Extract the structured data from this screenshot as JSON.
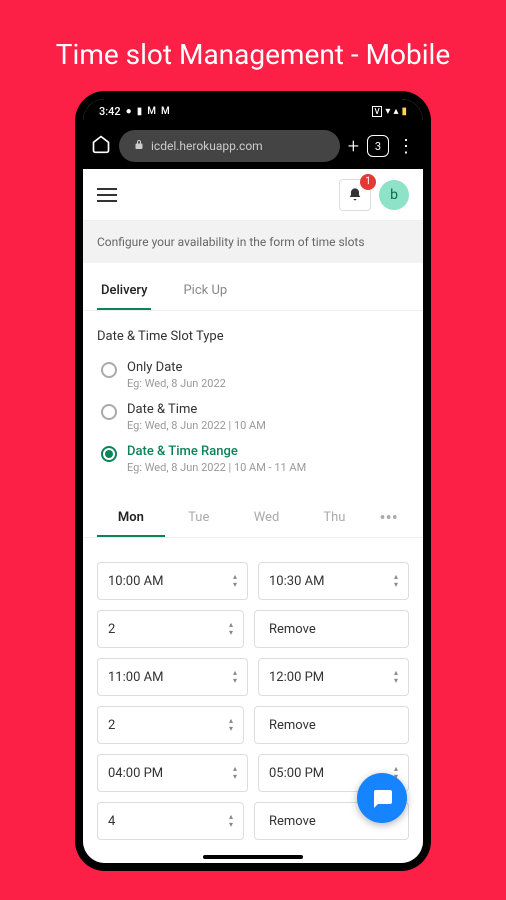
{
  "page_title": "Time slot Management - Mobile",
  "phone": {
    "status": {
      "time": "3:42",
      "tabs": "3"
    },
    "url": "icdel.herokuapp.com"
  },
  "header": {
    "badge": "1",
    "avatar": "b"
  },
  "description": "Configure your availability in the form of time slots",
  "tabs": [
    "Delivery",
    "Pick Up"
  ],
  "active_tab": 0,
  "section_title": "Date & Time Slot Type",
  "radios": [
    {
      "label": "Only Date",
      "eg": "Eg: Wed, 8 Jun 2022"
    },
    {
      "label": "Date & Time",
      "eg": "Eg: Wed, 8 Jun 2022 | 10 AM"
    },
    {
      "label": "Date & Time Range",
      "eg": "Eg: Wed, 8 Jun 2022 | 10 AM - 11 AM"
    }
  ],
  "selected_radio": 2,
  "days": [
    "Mon",
    "Tue",
    "Wed",
    "Thu"
  ],
  "active_day": 0,
  "slots": [
    {
      "from": "10:00 AM",
      "to": "10:30 AM",
      "qty": "2",
      "remove": "Remove"
    },
    {
      "from": "11:00 AM",
      "to": "12:00 PM",
      "qty": "2",
      "remove": "Remove"
    },
    {
      "from": "04:00 PM",
      "to": "05:00 PM",
      "qty": "4",
      "remove": "Remove"
    }
  ]
}
